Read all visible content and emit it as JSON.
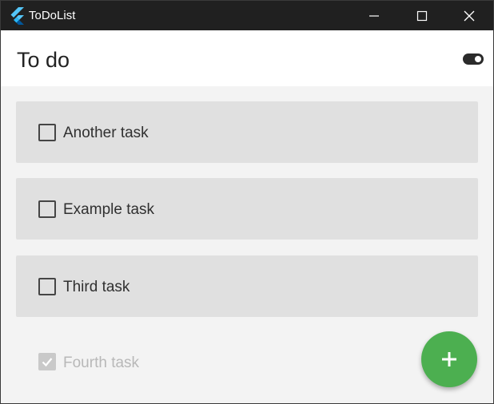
{
  "window": {
    "title": "ToDoList",
    "logo_icon": "flutter-logo-icon",
    "minimize_icon": "minimize-icon",
    "maximize_icon": "maximize-icon",
    "close_icon": "close-icon"
  },
  "appbar": {
    "title": "To do",
    "theme_toggle_icon": "toggle-icon"
  },
  "tasks": [
    {
      "label": "Another task",
      "checked": false
    },
    {
      "label": "Example task",
      "checked": false
    },
    {
      "label": "Third task",
      "checked": false
    }
  ],
  "completed_tasks": [
    {
      "label": "Fourth task",
      "checked": true
    }
  ],
  "fab": {
    "icon": "plus-icon",
    "color": "#4caf50"
  },
  "colors": {
    "titlebar": "#202020",
    "appbar": "#ffffff",
    "background": "#f3f3f3",
    "card": "#e0e0e0",
    "accent": "#4caf50"
  }
}
